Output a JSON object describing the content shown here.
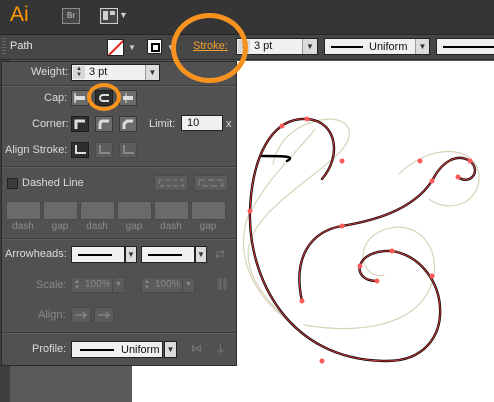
{
  "app": {
    "logo": "Ai",
    "bridge_label": "Br"
  },
  "control_bar": {
    "selection_type": "Path",
    "stroke_label": "Stroke:",
    "stroke_weight": "3 pt",
    "profile": "Uniform"
  },
  "stroke_panel": {
    "weight_label": "Weight:",
    "weight_value": "3 pt",
    "cap_label": "Cap:",
    "corner_label": "Corner:",
    "limit_label": "Limit:",
    "limit_value": "10",
    "limit_unit": "x",
    "align_label": "Align Stroke:",
    "dashed_label": "Dashed Line",
    "dash_labels": [
      "dash",
      "gap",
      "dash",
      "gap",
      "dash",
      "gap"
    ],
    "arrowheads_label": "Arrowheads:",
    "scale_label": "Scale:",
    "scale_start": "100%",
    "scale_end": "100%",
    "align_arrow_label": "Align:",
    "profile_label": "Profile:",
    "profile_value": "Uniform"
  },
  "colors": {
    "highlight": "#f7931e",
    "stroke_label": "#f2a02e",
    "anchor_points": "#ff5a5a"
  }
}
